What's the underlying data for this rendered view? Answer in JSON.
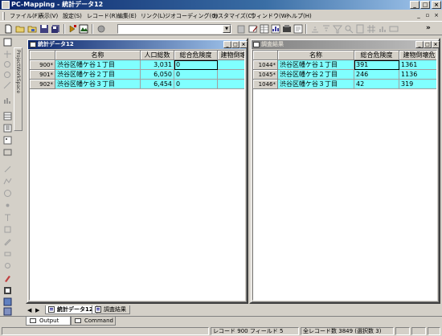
{
  "window": {
    "title": "PC-Mapping - 統計データ12",
    "minimize": "_",
    "maximize": "□",
    "close": "×"
  },
  "menu": {
    "items": [
      {
        "label": "ファイル(F)"
      },
      {
        "label": "表示(V)"
      },
      {
        "label": "設定(S)"
      },
      {
        "label": "レコード(R)"
      },
      {
        "label": "編集(E)"
      },
      {
        "label": "リンク(L)"
      },
      {
        "label": "ジオコーディング(G)"
      },
      {
        "label": "カスタマイズ(C)"
      },
      {
        "label": "ウィンドウ(W)"
      },
      {
        "label": "ヘルプ(H)"
      }
    ],
    "mdi_min": "_",
    "mdi_restore": "▫",
    "mdi_close": "×"
  },
  "toolbar": {
    "combo_value": "",
    "more": "»"
  },
  "left_dock": {
    "tab_label": "ProjectWorkSpace"
  },
  "windows": {
    "stats": {
      "title": "統計データ12",
      "columns": [
        "名称",
        "人口総数",
        "総合危険度",
        "建物倒壊"
      ],
      "rows": [
        {
          "id": "900*",
          "cells": [
            "渋谷区幡ケ谷１丁目",
            "3,031",
            "0",
            ""
          ]
        },
        {
          "id": "901*",
          "cells": [
            "渋谷区幡ケ谷２丁目",
            "6,050",
            "0",
            ""
          ]
        },
        {
          "id": "902*",
          "cells": [
            "渋谷区幡ケ谷３丁目",
            "6,454",
            "0",
            ""
          ]
        }
      ]
    },
    "survey": {
      "title": "調査結果",
      "columns": [
        "名称",
        "総合危険度",
        "建物倒壊危"
      ],
      "rows": [
        {
          "id": "1044*",
          "cells": [
            "渋谷区幡ケ谷１丁目",
            "391",
            "1361"
          ]
        },
        {
          "id": "1045*",
          "cells": [
            "渋谷区幡ケ谷２丁目",
            "246",
            "1136"
          ]
        },
        {
          "id": "1046*",
          "cells": [
            "渋谷区幡ケ谷３丁目",
            "42",
            "319"
          ]
        }
      ]
    }
  },
  "doc_tabs": [
    {
      "label": "統計データ12",
      "selected": true
    },
    {
      "label": "調査結果",
      "selected": false
    }
  ],
  "nav": {
    "prev": "◀",
    "next": "▶"
  },
  "output_tabs": [
    {
      "label": "Output"
    },
    {
      "label": "Command"
    }
  ],
  "status": {
    "record_label": "レコード",
    "record_value": "900",
    "field_label": "フィールド",
    "field_value": "5",
    "total_label": "全レコード数",
    "total_value": "3849",
    "selected_label": "(選択数",
    "selected_value": "3)"
  },
  "colors": {
    "selected_row": "#80ffff",
    "active_caption": "#0a246a",
    "inactive_caption": "#808080"
  }
}
